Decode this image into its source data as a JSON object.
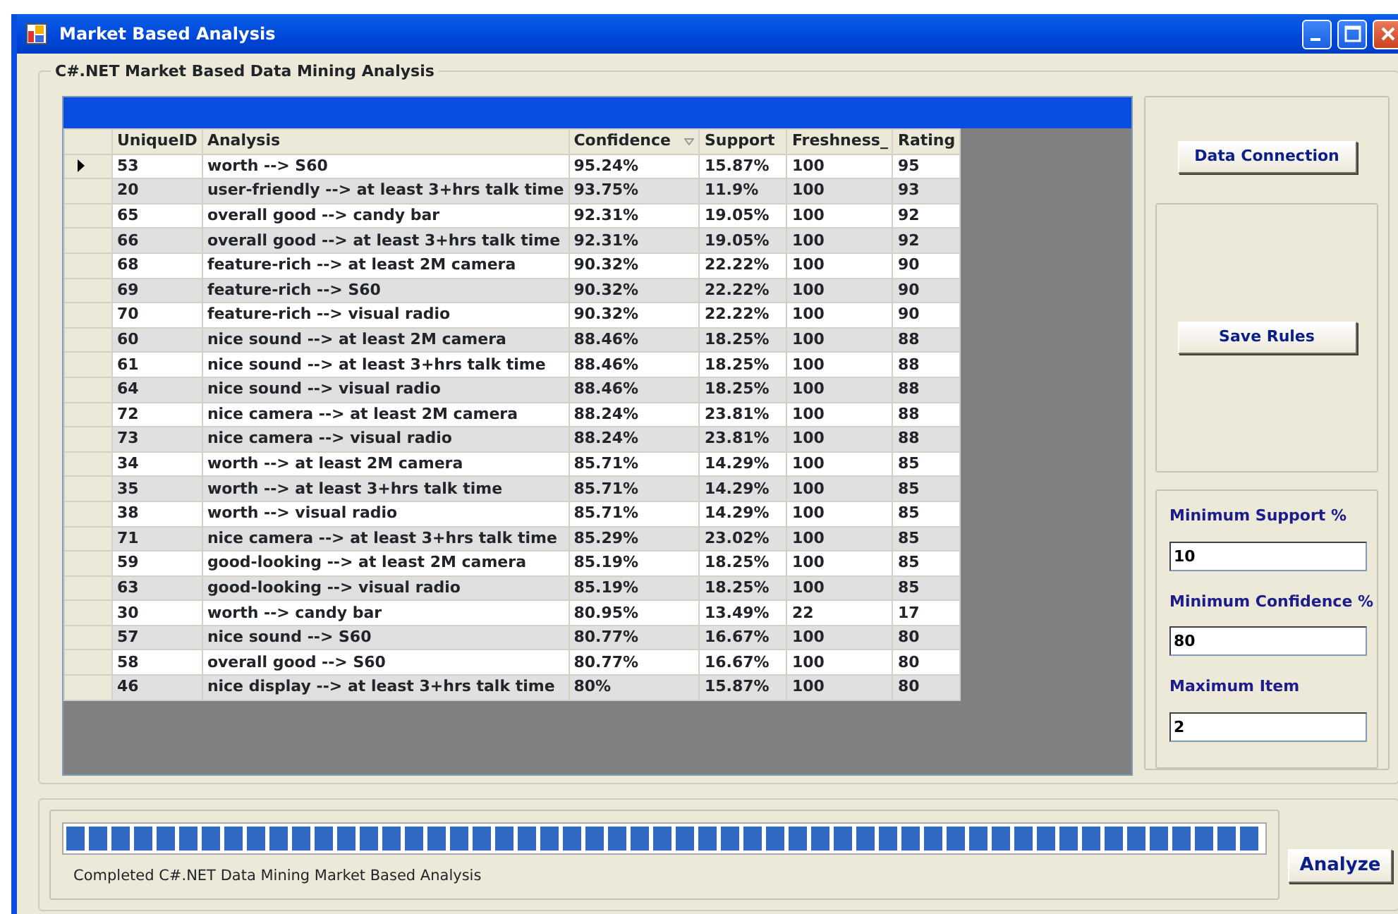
{
  "window": {
    "title": "Market Based Analysis"
  },
  "group_title": "C#.NET Market Based Data Mining Analysis",
  "table": {
    "columns": [
      {
        "label": "UniqueID",
        "sorted": false
      },
      {
        "label": "Analysis",
        "sorted": false
      },
      {
        "label": "Confidence",
        "sorted": true
      },
      {
        "label": "Support",
        "sorted": false
      },
      {
        "label": "Freshness_",
        "sorted": false
      },
      {
        "label": "Rating",
        "sorted": false
      }
    ],
    "rows": [
      {
        "selected": true,
        "cells": [
          "53",
          "worth --> S60",
          "95.24%",
          "15.87%",
          "100",
          "95"
        ]
      },
      {
        "selected": false,
        "cells": [
          "20",
          "user-friendly --> at least 3+hrs talk time",
          "93.75%",
          "11.9%",
          "100",
          "93"
        ]
      },
      {
        "selected": false,
        "cells": [
          "65",
          "overall good --> candy bar",
          "92.31%",
          "19.05%",
          "100",
          "92"
        ]
      },
      {
        "selected": false,
        "cells": [
          "66",
          "overall good --> at least 3+hrs talk time",
          "92.31%",
          "19.05%",
          "100",
          "92"
        ]
      },
      {
        "selected": false,
        "cells": [
          "68",
          "feature-rich --> at least 2M camera",
          "90.32%",
          "22.22%",
          "100",
          "90"
        ]
      },
      {
        "selected": false,
        "cells": [
          "69",
          "feature-rich --> S60",
          "90.32%",
          "22.22%",
          "100",
          "90"
        ]
      },
      {
        "selected": false,
        "cells": [
          "70",
          "feature-rich --> visual radio",
          "90.32%",
          "22.22%",
          "100",
          "90"
        ]
      },
      {
        "selected": false,
        "cells": [
          "60",
          "nice sound --> at least 2M camera",
          "88.46%",
          "18.25%",
          "100",
          "88"
        ]
      },
      {
        "selected": false,
        "cells": [
          "61",
          "nice sound --> at least 3+hrs talk time",
          "88.46%",
          "18.25%",
          "100",
          "88"
        ]
      },
      {
        "selected": false,
        "cells": [
          "64",
          "nice sound --> visual radio",
          "88.46%",
          "18.25%",
          "100",
          "88"
        ]
      },
      {
        "selected": false,
        "cells": [
          "72",
          "nice camera --> at least 2M camera",
          "88.24%",
          "23.81%",
          "100",
          "88"
        ]
      },
      {
        "selected": false,
        "cells": [
          "73",
          "nice camera --> visual radio",
          "88.24%",
          "23.81%",
          "100",
          "88"
        ]
      },
      {
        "selected": false,
        "cells": [
          "34",
          "worth --> at least 2M camera",
          "85.71%",
          "14.29%",
          "100",
          "85"
        ]
      },
      {
        "selected": false,
        "cells": [
          "35",
          "worth --> at least 3+hrs talk time",
          "85.71%",
          "14.29%",
          "100",
          "85"
        ]
      },
      {
        "selected": false,
        "cells": [
          "38",
          "worth --> visual radio",
          "85.71%",
          "14.29%",
          "100",
          "85"
        ]
      },
      {
        "selected": false,
        "cells": [
          "71",
          "nice camera --> at least 3+hrs talk time",
          "85.29%",
          "23.02%",
          "100",
          "85"
        ]
      },
      {
        "selected": false,
        "cells": [
          "59",
          "good-looking --> at least 2M camera",
          "85.19%",
          "18.25%",
          "100",
          "85"
        ]
      },
      {
        "selected": false,
        "cells": [
          "63",
          "good-looking --> visual radio",
          "85.19%",
          "18.25%",
          "100",
          "85"
        ]
      },
      {
        "selected": false,
        "cells": [
          "30",
          "worth --> candy bar",
          "80.95%",
          "13.49%",
          "22",
          "17"
        ]
      },
      {
        "selected": false,
        "cells": [
          "57",
          "nice sound --> S60",
          "80.77%",
          "16.67%",
          "100",
          "80"
        ]
      },
      {
        "selected": false,
        "cells": [
          "58",
          "overall good --> S60",
          "80.77%",
          "16.67%",
          "100",
          "80"
        ]
      },
      {
        "selected": false,
        "cells": [
          "46",
          "nice display --> at least 3+hrs talk time",
          "80%",
          "15.87%",
          "100",
          "80"
        ]
      }
    ]
  },
  "buttons": {
    "data_connection": "Data Connection",
    "save_rules": "Save Rules",
    "analyze": "Analyze"
  },
  "fields": [
    {
      "label": "Minimum Support %",
      "value": "10"
    },
    {
      "label": "Minimum Confidence %",
      "value": "80"
    },
    {
      "label": "Maximum Item",
      "value": "2"
    }
  ],
  "progress": {
    "level": 1,
    "status": "Completed C#.NET Data Mining Market Based Analysis"
  }
}
